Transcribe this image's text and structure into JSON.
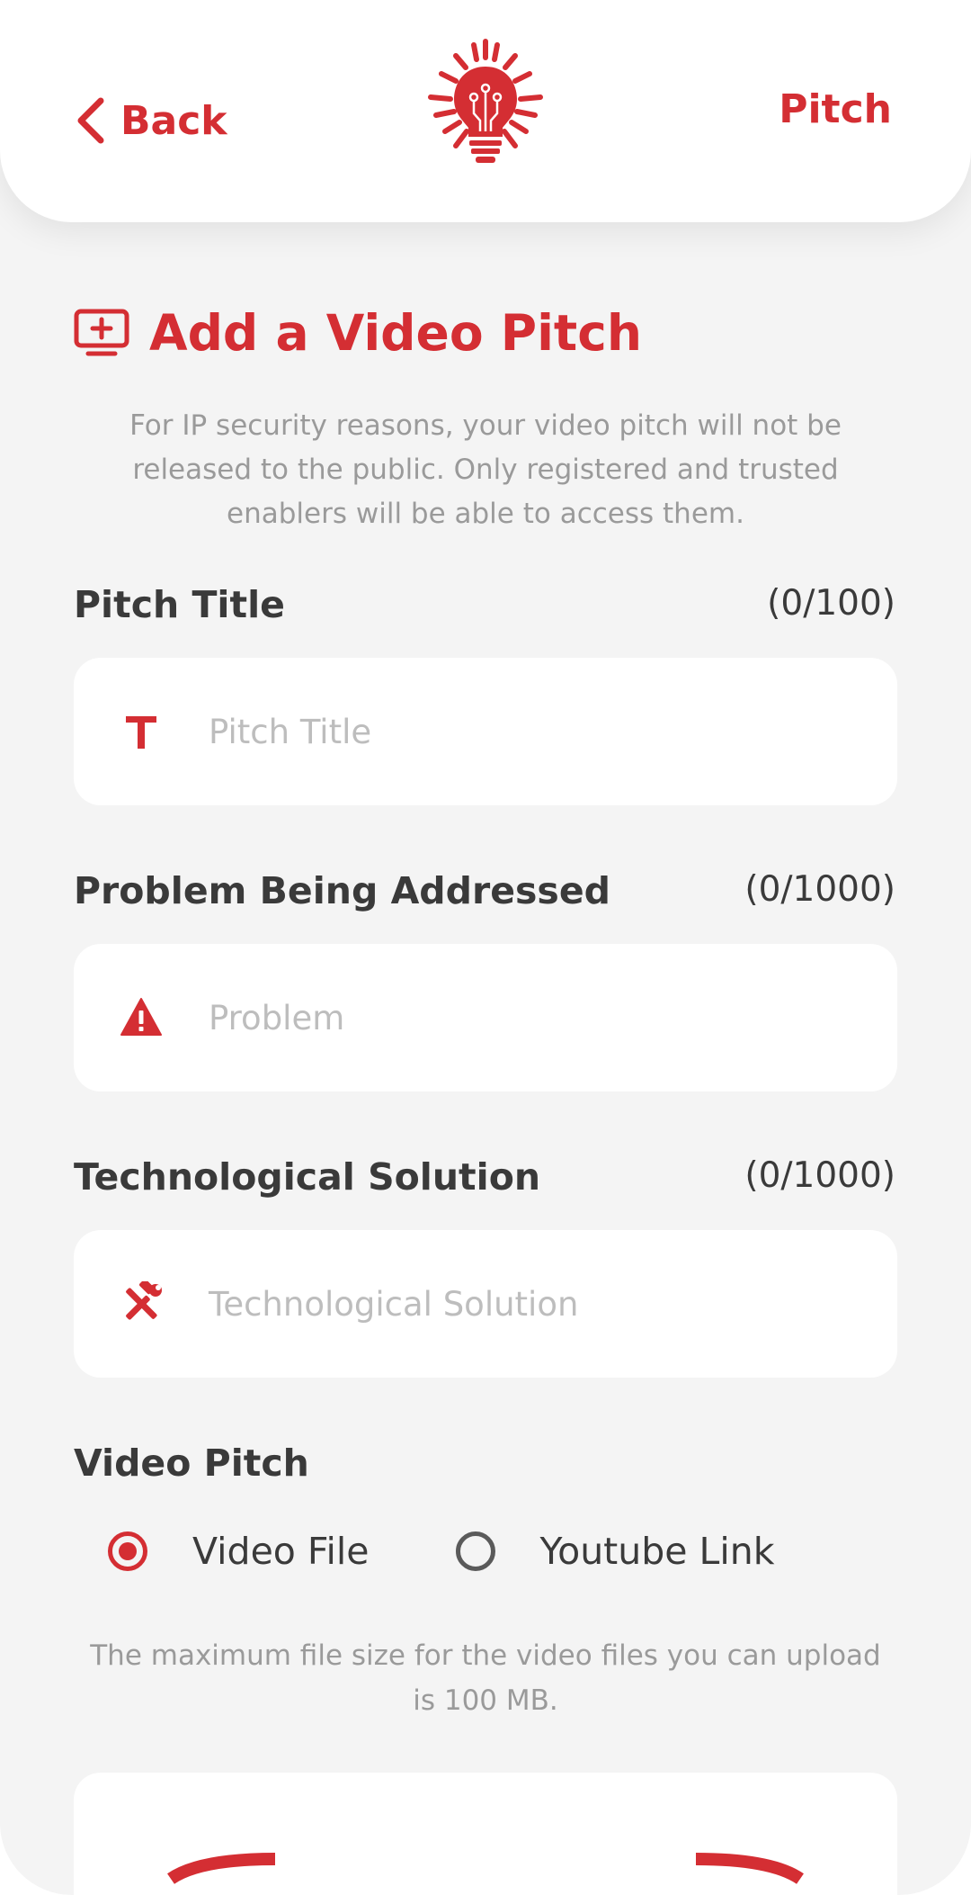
{
  "header": {
    "back_label": "Back",
    "right_link_label": "Pitch",
    "logo_icon": "lightbulb-circuit-icon"
  },
  "section": {
    "title": "Add a Video Pitch",
    "title_icon": "add-video-icon",
    "notice": "For IP security reasons, your video pitch will not be released to the public. Only registered and trusted enablers will be able to access them."
  },
  "fields": [
    {
      "label": "Pitch Title",
      "count": "(0/100)",
      "placeholder": "Pitch Title",
      "icon": "text-t-icon"
    },
    {
      "label": "Problem Being Addressed",
      "count": "(0/1000)",
      "placeholder": "Problem",
      "icon": "warning-icon"
    },
    {
      "label": "Technological Solution",
      "count": "(0/1000)",
      "placeholder": "Technological Solution",
      "icon": "tools-icon"
    }
  ],
  "video_pitch": {
    "label": "Video Pitch",
    "options": [
      {
        "label": "Video File",
        "selected": true
      },
      {
        "label": "Youtube Link",
        "selected": false
      }
    ],
    "size_note": "The maximum file size for the video files you can upload is 100 MB."
  },
  "colors": {
    "accent": "#d42e33",
    "background": "#f4f4f4",
    "text_dark": "#3a3a3a",
    "text_muted": "#9a9a9a",
    "placeholder": "#bdbdbd"
  }
}
